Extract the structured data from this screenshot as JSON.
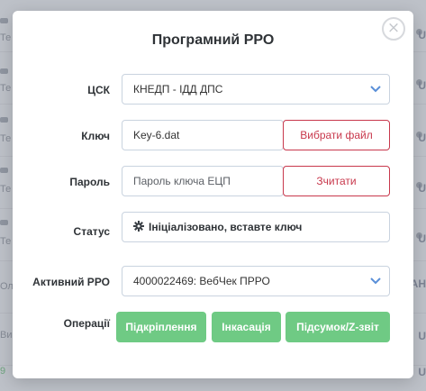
{
  "background": {
    "left_labels": [
      "Те",
      "Те",
      "Те",
      "Те",
      "Те",
      "Те",
      "Ол",
      "Ви",
      "9"
    ],
    "right_labels": [
      "U",
      "U",
      "U",
      "U",
      "U",
      "AH",
      "U",
      "U"
    ]
  },
  "modal": {
    "title": "Програмний РРО",
    "close_symbol": "×"
  },
  "form": {
    "csk": {
      "label": "ЦСК",
      "value": "КНЕДП - ІДД ДПС"
    },
    "key": {
      "label": "Ключ",
      "value": "Key-6.dat",
      "button": "Вибрати файл"
    },
    "password": {
      "label": "Пароль",
      "placeholder": "Пароль ключа ЕЦП",
      "button": "Зчитати"
    },
    "status": {
      "label": "Статус",
      "value": "Ініціалізовано, вставте ключ",
      "icon": "gear-icon"
    },
    "active_rro": {
      "label": "Активний РРО",
      "value": "4000022469: ВебЧек ПРРО"
    },
    "operations": {
      "label": "Операції",
      "buttons": [
        "Підкріплення",
        "Інкасація",
        "Підсумок/Z-звіт"
      ]
    }
  },
  "colors": {
    "accent_red": "#c8384c",
    "green": "#6fca84",
    "chevron_blue": "#5a8fd8"
  }
}
